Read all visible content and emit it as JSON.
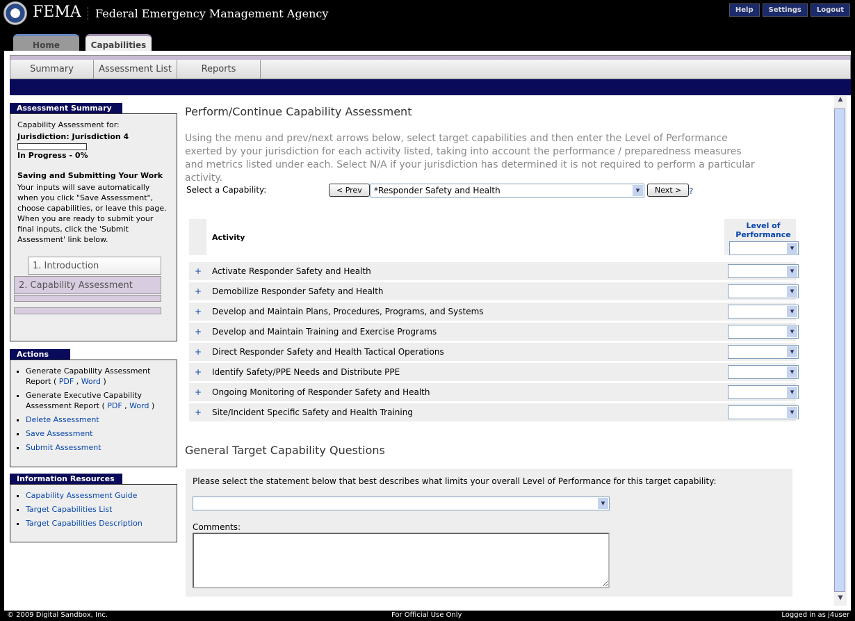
{
  "header": {
    "brand": "FEMA",
    "agency": "Federal Emergency Management Agency",
    "buttons": [
      "Help",
      "Settings",
      "Logout"
    ]
  },
  "tabs": [
    "Home",
    "Capabilities"
  ],
  "subnav": [
    "Summary",
    "Assessment List",
    "Reports"
  ],
  "summary": {
    "title": "Assessment Summary",
    "for": "Capability Assessment for:",
    "jurisdiction": "Jurisdiction: Jurisdiction 4",
    "progress_percent": 0,
    "status": "In Progress - 0%",
    "save_title": "Saving and Submitting Your Work",
    "save_text": "Your inputs will save automatically when you click \"Save Assessment\", choose capabilities, or leave this page. When you are ready to submit your final inputs, click the 'Submit Assessment' link below.",
    "steps": [
      "1. Introduction",
      "2. Capability Assessment"
    ]
  },
  "actions": {
    "title": "Actions",
    "gen1": "Generate Capability Assessment Report (",
    "gen2": "Generate Executive Capability Assessment Report (",
    "pdf": "PDF",
    "word": "Word",
    "links": [
      "Delete Assessment",
      "Save Assessment",
      "Submit Assessment"
    ]
  },
  "resources": {
    "title": "Information Resources",
    "links": [
      "Capability Assessment Guide",
      "Target Capabilities List",
      "Target Capabilities Description"
    ]
  },
  "main": {
    "title": "Perform/Continue Capability Assessment",
    "intro": "Using the menu and prev/next arrows below, select target capabilities and then enter the Level of Performance exerted by your jurisdiction for each activity listed, taking into account the performance / preparedness measures and metrics listed under each. Select N/A if your jurisdiction has determined it is not required to perform a particular activity.",
    "select_label": "Select a Capability:",
    "prev": "< Prev",
    "next": "Next >",
    "capability": "*Responder Safety and Health",
    "help": "?",
    "col_activity": "Activity",
    "col_level": "Level of Performance",
    "activities": [
      "Activate Responder Safety and Health",
      "Demobilize Responder Safety and Health",
      "Develop and Maintain Plans, Procedures, Programs, and Systems",
      "Develop and Maintain Training and Exercise Programs",
      "Direct Responder Safety and Health Tactical Operations",
      "Identify Safety/PPE Needs and Distribute PPE",
      "Ongoing Monitoring of Responder Safety and Health",
      "Site/Incident Specific Safety and Health Training"
    ],
    "general_title": "General Target Capability Questions",
    "question": "Please select the statement below that best describes what limits your overall Level of Performance for this target capability:",
    "comments": "Comments:"
  },
  "footer": {
    "copyright": "© 2009 Digital Sandbox, Inc.",
    "center": "For Official Use Only",
    "user": "Logged in as j4user"
  }
}
